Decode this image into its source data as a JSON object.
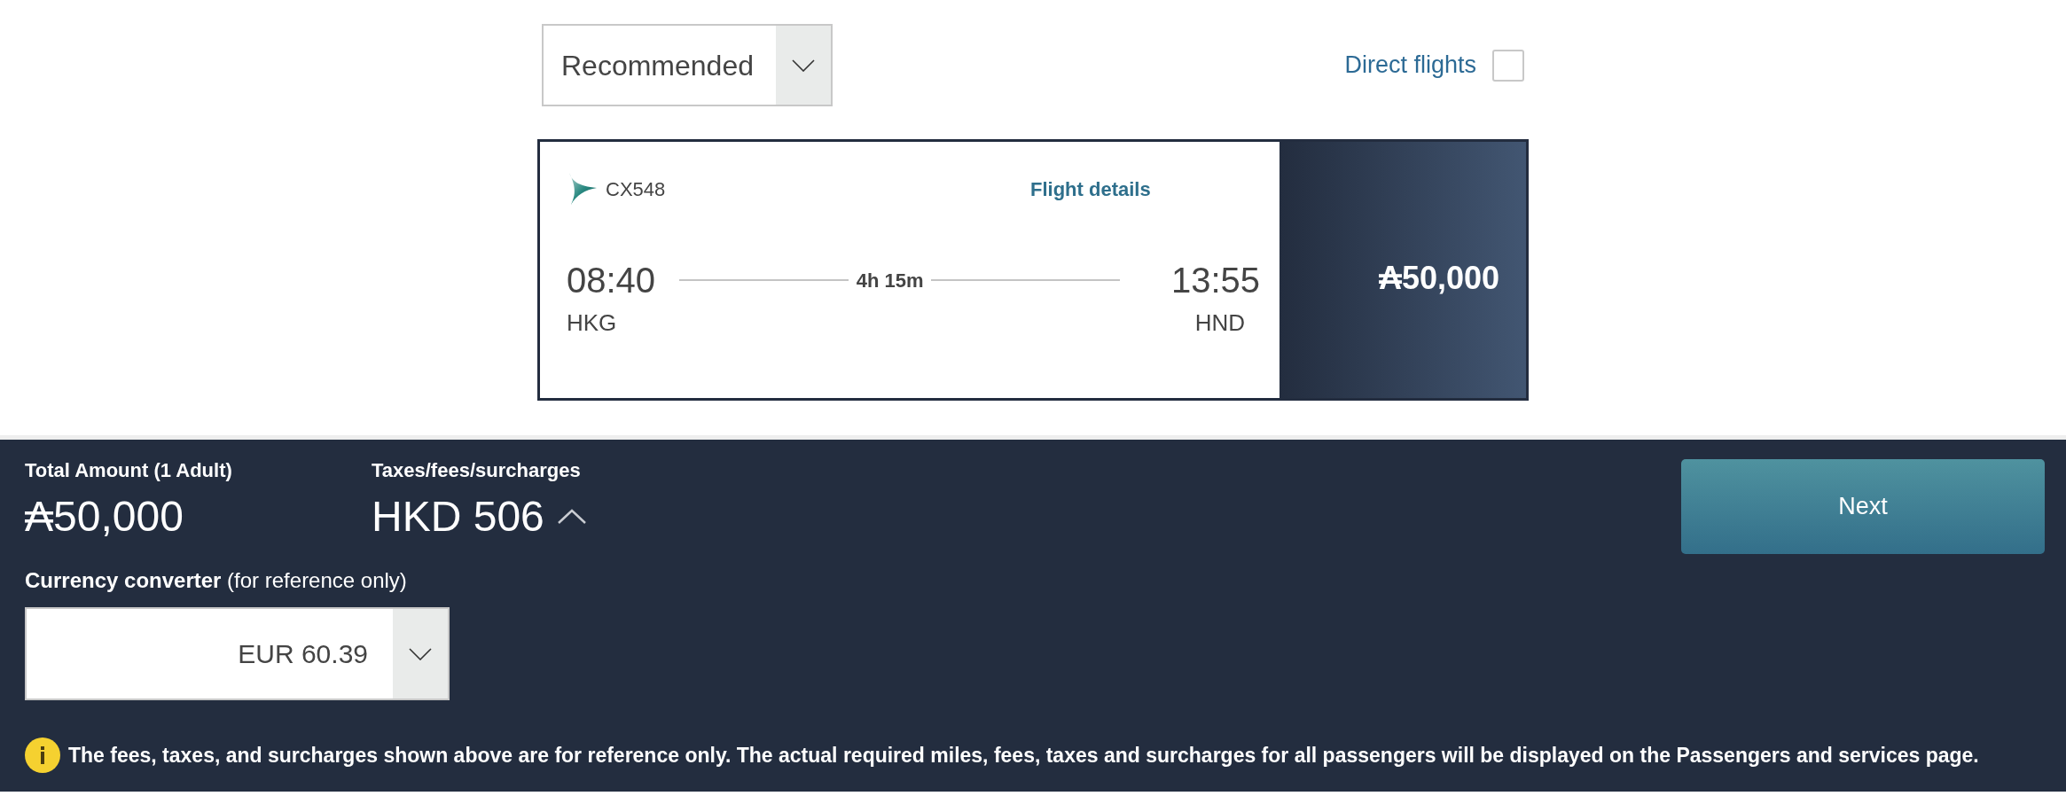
{
  "sort": {
    "value": "Recommended"
  },
  "direct_flights": {
    "label": "Direct flights",
    "checked": false
  },
  "flights": [
    {
      "flight_number": "CX548",
      "details_link": "Flight details",
      "departure": {
        "time": "08:40",
        "airport": "HKG"
      },
      "duration": "4h 15m",
      "arrival": {
        "time": "13:55",
        "airport": "HND"
      },
      "price": "₳50,000"
    }
  ],
  "summary": {
    "total_label": "Total Amount (1 Adult)",
    "total_value": "₳50,000",
    "taxes_label": "Taxes/fees/surcharges",
    "taxes_value": "HKD 506"
  },
  "currency_converter": {
    "label": "**Currency converter** (for reference only)",
    "value": "EUR 60.39"
  },
  "next_button": {
    "label": "Next"
  },
  "notice": "The fees, taxes, and surcharges shown above are for reference only. The actual required miles, fees, taxes and surcharges for all passengers will be displayed on the Passengers and services page."
}
